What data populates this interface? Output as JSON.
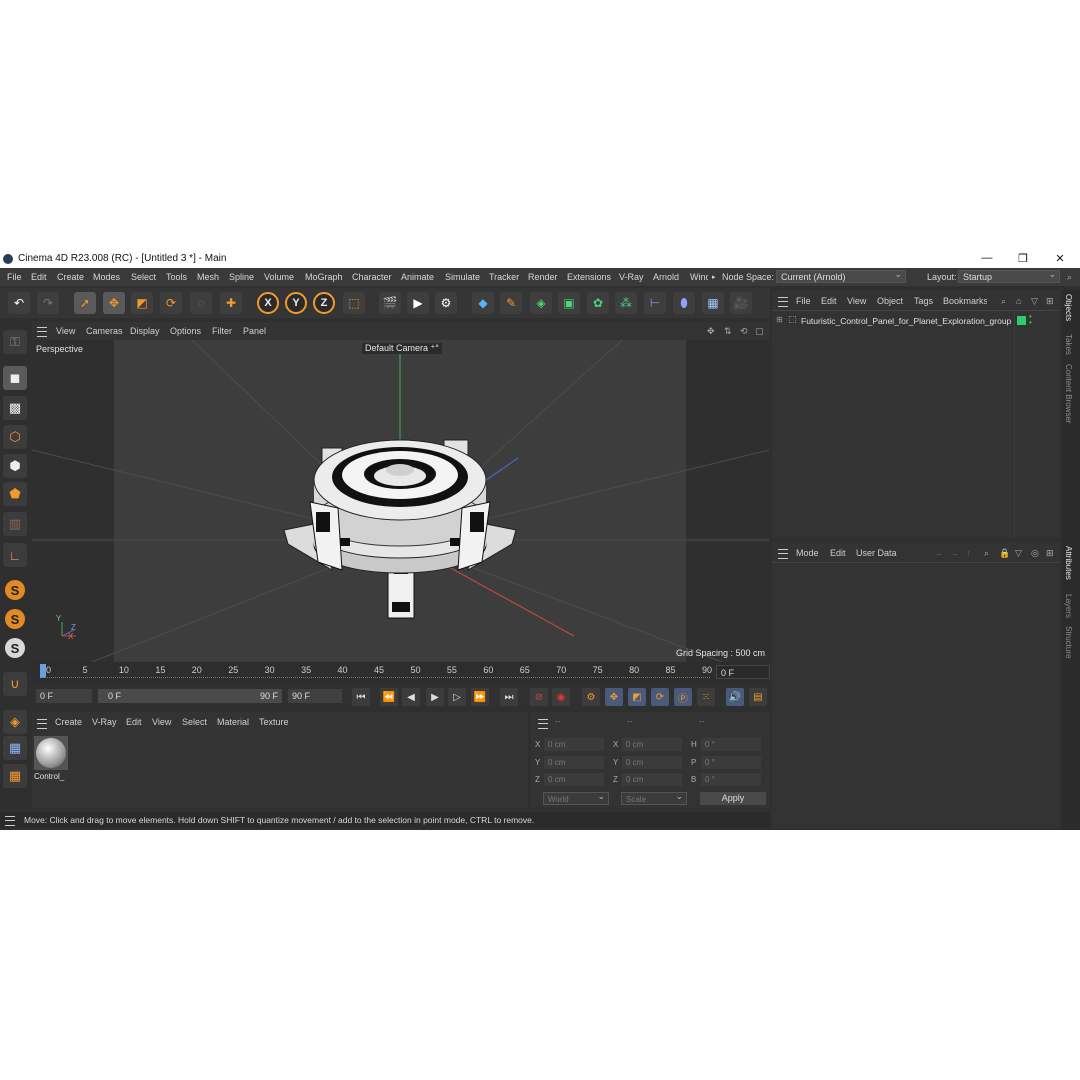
{
  "window": {
    "title": "Cinema 4D R23.008 (RC) - [Untitled 3 *] - Main"
  },
  "menu": {
    "items": [
      "File",
      "Edit",
      "Create",
      "Modes",
      "Select",
      "Tools",
      "Mesh",
      "Spline",
      "Volume",
      "MoGraph",
      "Character",
      "Animate",
      "Simulate",
      "Tracker",
      "Render",
      "Extensions",
      "V-Ray",
      "Arnold",
      "Wind"
    ],
    "node_space_label": "Node Space:",
    "node_space_value": "Current (Arnold)",
    "layout_label": "Layout:",
    "layout_value": "Startup"
  },
  "toolbar": {
    "axis_labels": [
      "X",
      "Y",
      "Z"
    ]
  },
  "viewport": {
    "menu": [
      "View",
      "Cameras",
      "Display",
      "Options",
      "Filter",
      "Panel"
    ],
    "label": "Perspective",
    "camera": "Default Camera",
    "grid_spacing": "Grid Spacing : 500 cm",
    "axis_labels": [
      "Y",
      "Z",
      "X"
    ]
  },
  "timeline": {
    "ticks": [
      "0",
      "5",
      "10",
      "15",
      "20",
      "25",
      "30",
      "35",
      "40",
      "45",
      "50",
      "55",
      "60",
      "65",
      "70",
      "75",
      "80",
      "85",
      "90"
    ],
    "current_frame": "0 F",
    "start_field": "0 F",
    "range_start": "0 F",
    "range_end": "90 F",
    "end_field": "90 F"
  },
  "materials": {
    "menu": [
      "Create",
      "V-Ray",
      "Edit",
      "View",
      "Select",
      "Material",
      "Texture"
    ],
    "item_label": "Control_"
  },
  "coords": {
    "headers": [
      "--",
      "--",
      "--"
    ],
    "rows": [
      {
        "a": "X",
        "av": "0 cm",
        "b": "X",
        "bv": "0 cm",
        "c": "H",
        "cv": "0 °"
      },
      {
        "a": "Y",
        "av": "0 cm",
        "b": "Y",
        "bv": "0 cm",
        "c": "P",
        "cv": "0 °"
      },
      {
        "a": "Z",
        "av": "0 cm",
        "b": "Z",
        "bv": "0 cm",
        "c": "B",
        "cv": "0 °"
      }
    ],
    "world": "World",
    "scale": "Scale",
    "apply": "Apply"
  },
  "status": {
    "text": "Move: Click and drag to move elements. Hold down SHIFT to quantize movement / add to the selection in point mode, CTRL to remove."
  },
  "objects": {
    "menu": [
      "File",
      "Edit",
      "View",
      "Object",
      "Tags",
      "Bookmarks"
    ],
    "item": "Futuristic_Control_Panel_for_Planet_Exploration_group",
    "tag_color": "#2ecc71"
  },
  "attributes": {
    "menu": [
      "Mode",
      "Edit",
      "User Data"
    ]
  },
  "side_tabs": {
    "right": [
      "Objects",
      "Takes",
      "Content Browser",
      "Attributes",
      "Layers",
      "Structure"
    ]
  },
  "colors": {
    "accent": "#f29a2e",
    "bg": "#2f2f2f",
    "panel": "#333333"
  }
}
